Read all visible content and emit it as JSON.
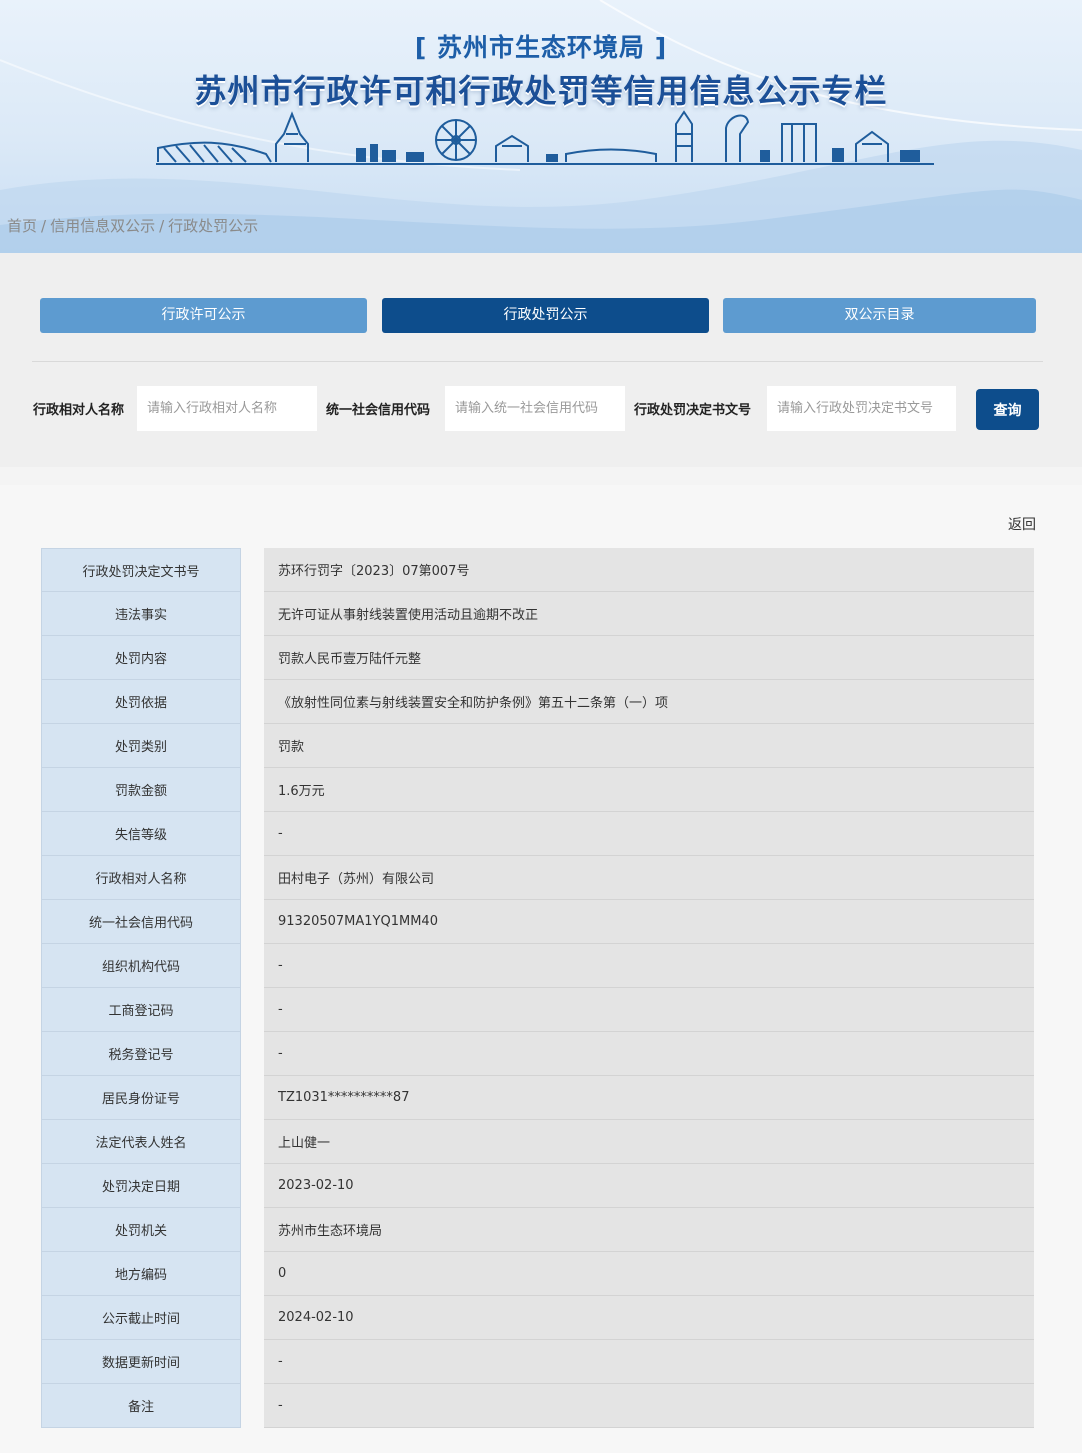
{
  "banner": {
    "dept_title": "[ 苏州市生态环境局 ]",
    "main_title": "苏州市行政许可和行政处罚等信用信息公示专栏"
  },
  "breadcrumb": [
    "首页",
    "信用信息双公示",
    "行政处罚公示"
  ],
  "tabs": [
    {
      "label": "行政许可公示",
      "active": false
    },
    {
      "label": "行政处罚公示",
      "active": true
    },
    {
      "label": "双公示目录",
      "active": false
    }
  ],
  "filters": {
    "name_label": "行政相对人名称",
    "name_placeholder": "请输入行政相对人名称",
    "code_label": "统一社会信用代码",
    "code_placeholder": "请输入统一社会信用代码",
    "doc_label": "行政处罚决定书文号",
    "doc_placeholder": "请输入行政处罚决定书文号",
    "search_label": "查询"
  },
  "back_label": "返回",
  "records": [
    {
      "key": "行政处罚决定文书号",
      "value": "苏环行罚字〔2023〕07第007号"
    },
    {
      "key": "违法事实",
      "value": "无许可证从事射线装置使用活动且逾期不改正"
    },
    {
      "key": "处罚内容",
      "value": "罚款人民币壹万陆仟元整"
    },
    {
      "key": "处罚依据",
      "value": "《放射性同位素与射线装置安全和防护条例》第五十二条第（一）项"
    },
    {
      "key": "处罚类别",
      "value": "罚款"
    },
    {
      "key": "罚款金额",
      "value": "1.6万元"
    },
    {
      "key": "失信等级",
      "value": "-"
    },
    {
      "key": "行政相对人名称",
      "value": "田村电子（苏州）有限公司"
    },
    {
      "key": "统一社会信用代码",
      "value": "91320507MA1YQ1MM40"
    },
    {
      "key": "组织机构代码",
      "value": "-"
    },
    {
      "key": "工商登记码",
      "value": "-"
    },
    {
      "key": "税务登记号",
      "value": "-"
    },
    {
      "key": "居民身份证号",
      "value": "TZ1031**********87"
    },
    {
      "key": "法定代表人姓名",
      "value": "上山健一"
    },
    {
      "key": "处罚决定日期",
      "value": "2023-02-10"
    },
    {
      "key": "处罚机关",
      "value": "苏州市生态环境局"
    },
    {
      "key": "地方编码",
      "value": "0"
    },
    {
      "key": "公示截止时间",
      "value": "2024-02-10"
    },
    {
      "key": "数据更新时间",
      "value": "-"
    },
    {
      "key": "备注",
      "value": "-"
    }
  ]
}
